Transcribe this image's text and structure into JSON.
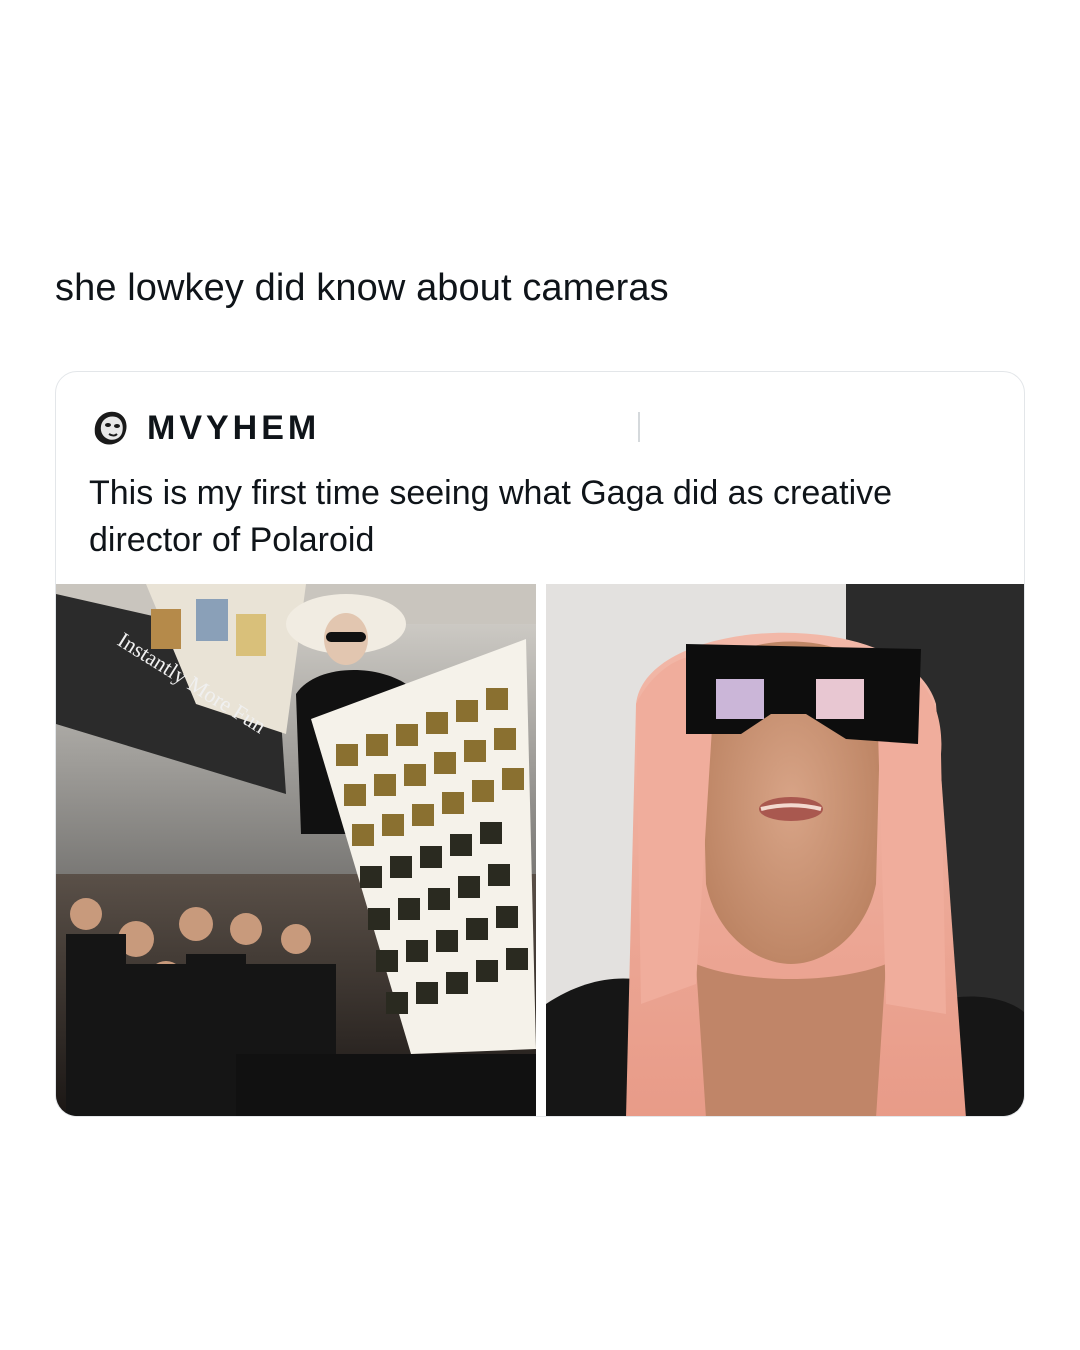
{
  "post": {
    "caption": "she lowkey did know about cameras"
  },
  "quoted_post": {
    "author_name": "MVYHEM",
    "text": "This is my first time seeing what Gaga did as creative director of Polaroid",
    "avatar_icon": "face-avatar-icon",
    "media": [
      {
        "name": "photo-polaroid-event",
        "banner_text": "Instantly More Fun"
      },
      {
        "name": "photo-camera-glasses"
      }
    ]
  },
  "colors": {
    "text": "#0f1419",
    "border": "#e3e6e9",
    "background": "#ffffff"
  }
}
